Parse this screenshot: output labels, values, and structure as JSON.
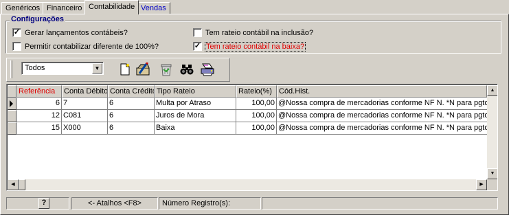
{
  "tabs": [
    {
      "label": "Genéricos"
    },
    {
      "label": "Financeiro"
    },
    {
      "label": "Contabilidade"
    },
    {
      "label": "Vendas"
    }
  ],
  "config": {
    "title": "Configurações",
    "checkboxes": [
      {
        "label": "Gerar lançamentos contábeis?",
        "checked": true
      },
      {
        "label": "Permitir contabilizar diferente de 100%?",
        "checked": false
      },
      {
        "label": "Tem rateio contábil na inclusão?",
        "checked": false
      },
      {
        "label": "Tem rateio contábil na baixa?",
        "checked": true
      }
    ]
  },
  "toolbar": {
    "filter_value": "Todos",
    "buttons": [
      "new-document-icon",
      "edit-icon",
      "delete-icon",
      "search-icon",
      "print-icon"
    ]
  },
  "grid": {
    "columns": [
      "Referência",
      "Conta Débito",
      "Conta Crédito",
      "Tipo Rateio",
      "Rateio(%)",
      "Cód.Hist."
    ],
    "rows": [
      [
        "6",
        "7",
        "6",
        "Multa por Atraso",
        "100,00",
        "@Nossa compra de mercadorias conforme NF N. *N para pgto e"
      ],
      [
        "12",
        "C081",
        "6",
        "Juros de Mora",
        "100,00",
        "@Nossa compra de mercadorias conforme NF N. *N para pgto e"
      ],
      [
        "15",
        "X000",
        "6",
        "Baixa",
        "100,00",
        "@Nossa compra de mercadorias conforme NF N. *N para pgto e"
      ]
    ]
  },
  "statusbar": {
    "help": "?",
    "shortcuts": "<- Atalhos <F8>",
    "records": "Número Registro(s):"
  },
  "colors": {
    "face": "#d4d0c8",
    "highlight_red": "#e00000",
    "link_blue": "#0000c8",
    "group_title": "#000080"
  }
}
